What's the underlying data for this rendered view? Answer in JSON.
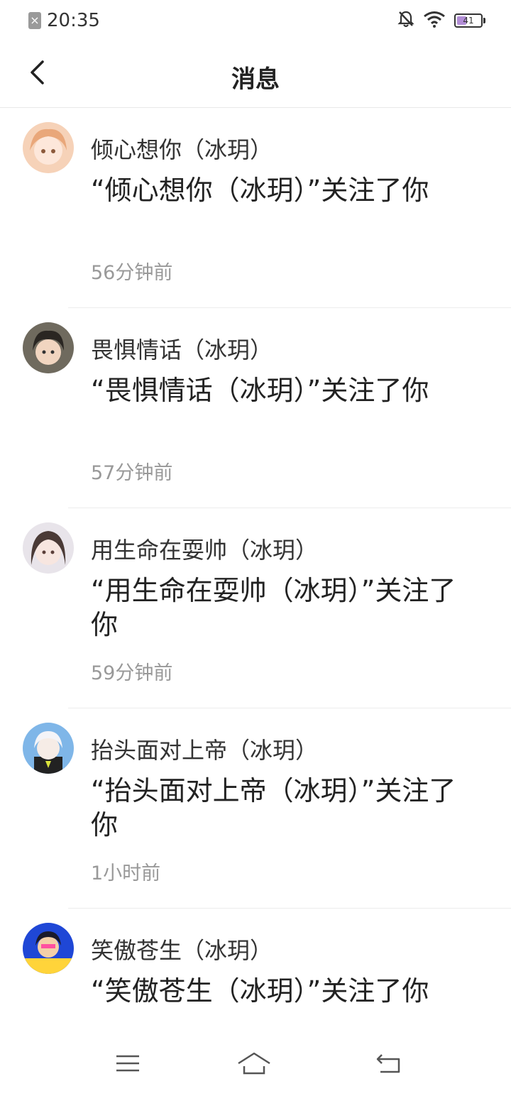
{
  "status_bar": {
    "time": "20:35",
    "battery_level": 41,
    "battery_text": "41",
    "icons": [
      "sim-error-icon",
      "bell-muted-icon",
      "wifi-icon",
      "battery-icon"
    ]
  },
  "header": {
    "title": "消息",
    "back_icon": "chevron-left-icon"
  },
  "messages": [
    {
      "name": "倾心想你（冰玥）",
      "text": "“倾心想你（冰玥）”关注了你",
      "time": "56分钟前"
    },
    {
      "name": "畏惧情话（冰玥）",
      "text": "“畏惧情话（冰玥）”关注了你",
      "time": "57分钟前"
    },
    {
      "name": "用生命在耍帅（冰玥）",
      "text": "“用生命在耍帅（冰玥）”关注了你",
      "time": "59分钟前"
    },
    {
      "name": "抬头面对上帝（冰玥）",
      "text": "“抬头面对上帝（冰玥）”关注了你",
      "time": "1小时前"
    },
    {
      "name": "笑傲苍生（冰玥）",
      "text": "“笑傲苍生（冰玥）”关注了你",
      "time": ""
    }
  ],
  "system_nav": {
    "icons": [
      "menu-icon",
      "home-icon",
      "back-return-icon"
    ]
  },
  "colors": {
    "text_primary": "#222222",
    "text_secondary": "#999999",
    "divider": "#ececec",
    "battery_fill": "#b28dd6"
  }
}
